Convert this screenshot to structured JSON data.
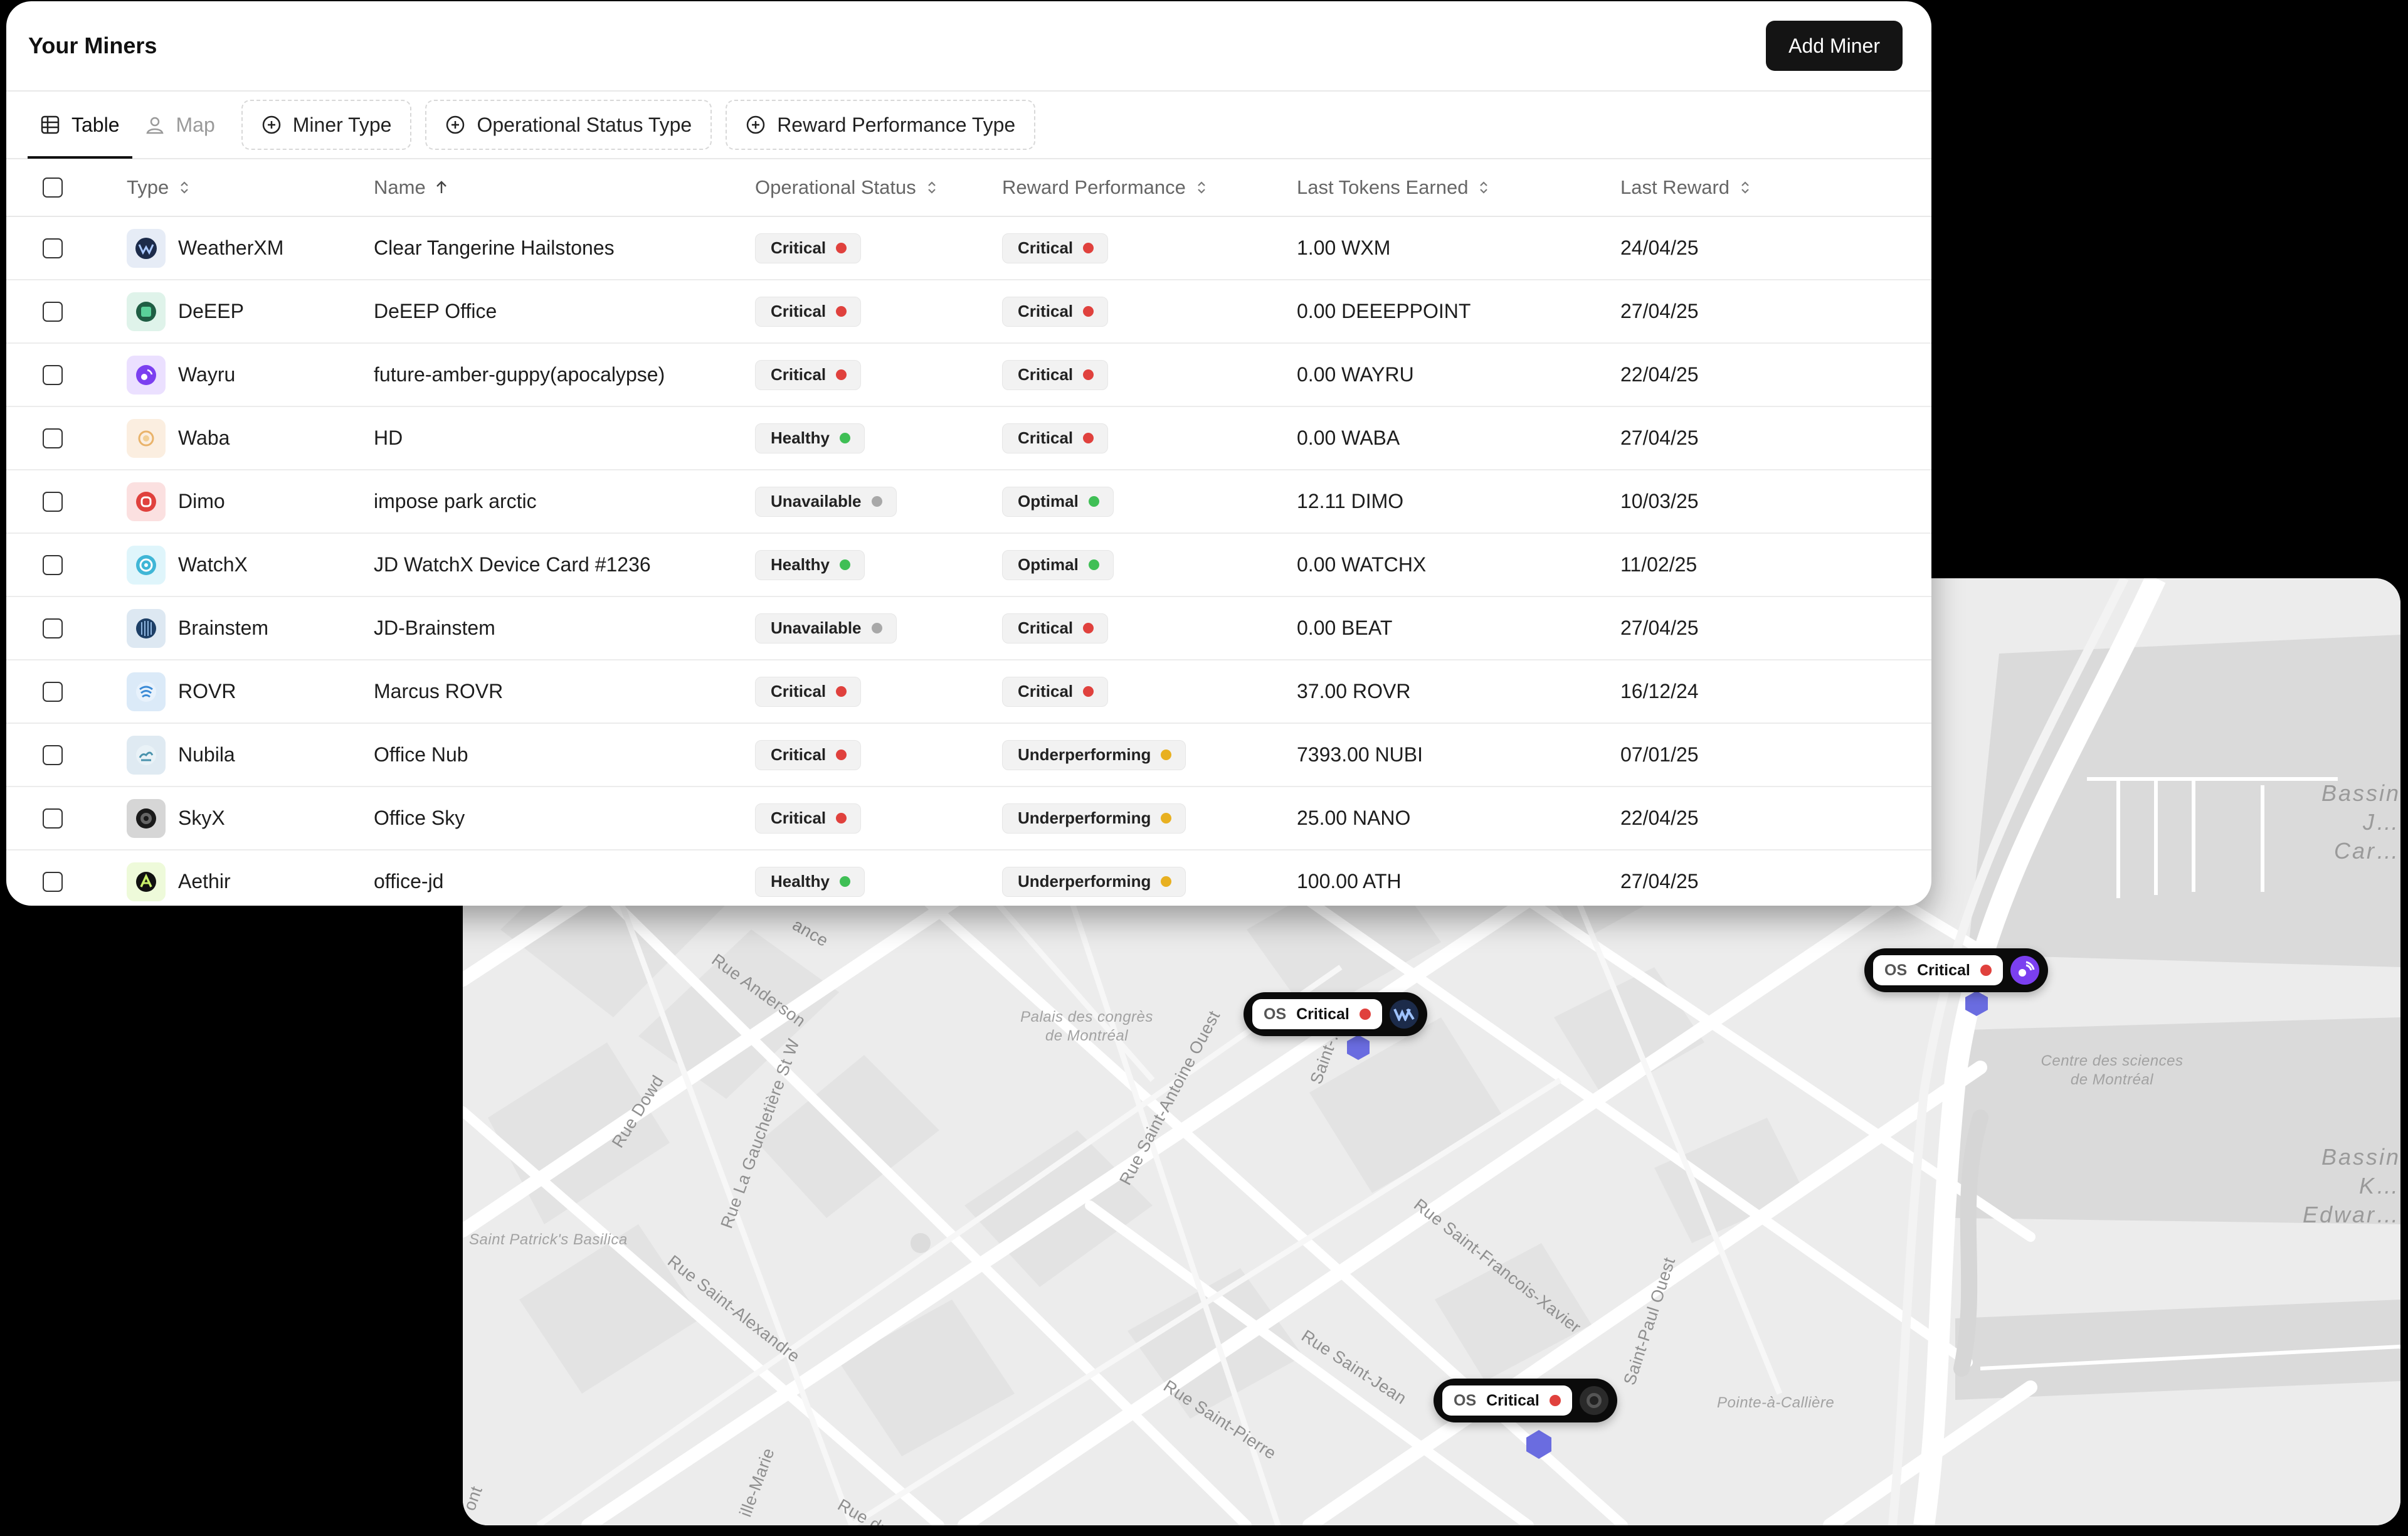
{
  "header": {
    "title": "Your Miners",
    "add_button": "Add Miner"
  },
  "views": [
    {
      "label": "Table",
      "icon": "grid-icon",
      "active": true
    },
    {
      "label": "Map",
      "icon": "map-pin-person-icon",
      "active": false
    }
  ],
  "filters": [
    {
      "label": "Miner Type",
      "icon": "plus-circle-icon"
    },
    {
      "label": "Operational Status Type",
      "icon": "plus-circle-icon"
    },
    {
      "label": "Reward Performance Type",
      "icon": "plus-circle-icon"
    }
  ],
  "columns": {
    "type": "Type",
    "name": "Name",
    "operational_status": "Operational Status",
    "reward_performance": "Reward Performance",
    "last_tokens": "Last Tokens Earned",
    "last_reward": "Last Reward"
  },
  "status_colors": {
    "Critical": "#e0413d",
    "Healthy": "#3fbf55",
    "Unavailable": "#a8a8a8",
    "Optimal": "#3fbf55",
    "Underperforming": "#e8b020"
  },
  "rows": [
    {
      "type": "WeatherXM",
      "name": "Clear Tangerine Hailstones",
      "op_status": "Critical",
      "reward_perf": "Critical",
      "tokens": "1.00 WXM",
      "date": "24/04/25"
    },
    {
      "type": "DeEEP",
      "name": "DeEEP Office",
      "op_status": "Critical",
      "reward_perf": "Critical",
      "tokens": "0.00 DEEEPPOINT",
      "date": "27/04/25"
    },
    {
      "type": "Wayru",
      "name": "future-amber-guppy(apocalypse)",
      "op_status": "Critical",
      "reward_perf": "Critical",
      "tokens": "0.00 WAYRU",
      "date": "22/04/25"
    },
    {
      "type": "Waba",
      "name": "HD",
      "op_status": "Healthy",
      "reward_perf": "Critical",
      "tokens": "0.00 WABA",
      "date": "27/04/25"
    },
    {
      "type": "Dimo",
      "name": "impose park arctic",
      "op_status": "Unavailable",
      "reward_perf": "Optimal",
      "tokens": "12.11 DIMO",
      "date": "10/03/25"
    },
    {
      "type": "WatchX",
      "name": "JD WatchX Device Card #1236",
      "op_status": "Healthy",
      "reward_perf": "Optimal",
      "tokens": "0.00 WATCHX",
      "date": "11/02/25"
    },
    {
      "type": "Brainstem",
      "name": "JD-Brainstem",
      "op_status": "Unavailable",
      "reward_perf": "Critical",
      "tokens": "0.00 BEAT",
      "date": "27/04/25"
    },
    {
      "type": "ROVR",
      "name": "Marcus ROVR",
      "op_status": "Critical",
      "reward_perf": "Critical",
      "tokens": "37.00 ROVR",
      "date": "16/12/24"
    },
    {
      "type": "Nubila",
      "name": "Office Nub",
      "op_status": "Critical",
      "reward_perf": "Underperforming",
      "tokens": "7393.00 NUBI",
      "date": "07/01/25"
    },
    {
      "type": "SkyX",
      "name": "Office Sky",
      "op_status": "Critical",
      "reward_perf": "Underperforming",
      "tokens": "25.00 NANO",
      "date": "22/04/25"
    },
    {
      "type": "Aethir",
      "name": "office-jd",
      "op_status": "Healthy",
      "reward_perf": "Underperforming",
      "tokens": "100.00 ATH",
      "date": "27/04/25"
    }
  ],
  "map": {
    "streets": [
      "Rue Anderson",
      "Rue Dowd",
      "Rue La Gauchetière St W",
      "Rue Saint-Alexandre",
      "Rue Saint-Antoine Ouest",
      "Saint-…-St",
      "Rue Saint-Francois-Xavier",
      "Rue Saint-Jean",
      "Rue Saint-Pierre",
      "Saint-Paul Ouest",
      "ance",
      "ille-Marie",
      "Rue du C…",
      "ont"
    ],
    "places": [
      "Palais des congrès de Montréal",
      "Saint Patrick's Basilica",
      "Centre des sciences de Montréal",
      "Pointe-à-Callière"
    ],
    "water": [
      "Bassin J… Car…",
      "Bassin K… Edwar…"
    ],
    "pins": [
      {
        "prefix": "OS",
        "status": "Critical",
        "miner": "WeatherXM"
      },
      {
        "prefix": "OS",
        "status": "Critical",
        "miner": "Wayru"
      },
      {
        "prefix": "OS",
        "status": "Critical",
        "miner": "SkyX"
      }
    ]
  }
}
